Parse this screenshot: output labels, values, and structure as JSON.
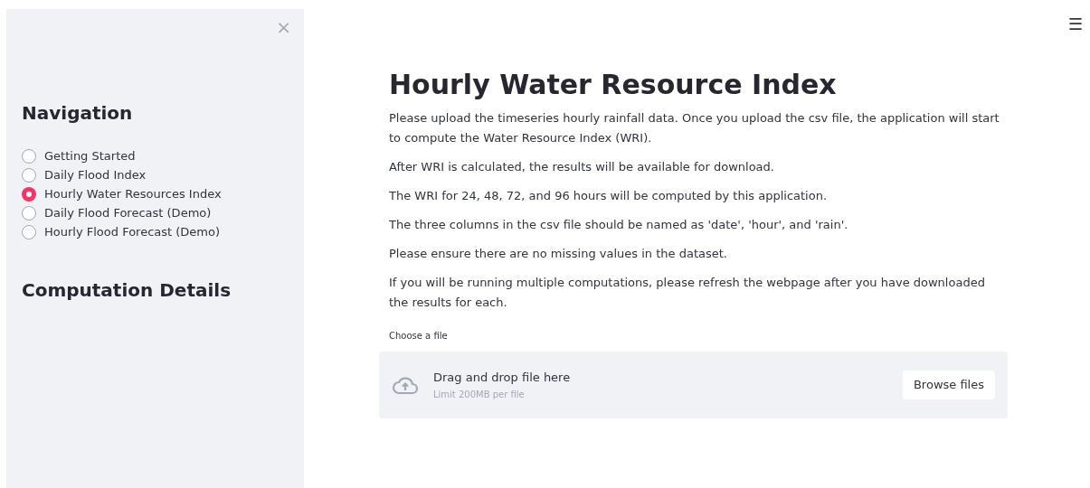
{
  "sidebar": {
    "close": "×",
    "headings": [
      "Navigation",
      "Computation Details"
    ],
    "nav": [
      {
        "label": "Getting Started",
        "selected": false
      },
      {
        "label": "Daily Flood Index",
        "selected": false
      },
      {
        "label": "Hourly Water Resources Index",
        "selected": true
      },
      {
        "label": "Daily Flood Forecast (Demo)",
        "selected": false
      },
      {
        "label": "Hourly Flood Forecast (Demo)",
        "selected": false
      }
    ]
  },
  "menu": "☰",
  "main": {
    "title": "Hourly Water Resource Index",
    "paragraphs": [
      "Please upload the timeseries hourly rainfall data. Once you upload the csv file, the application will start to compute the Water Resource Index (WRI).",
      "After WRI is calculated, the results will be available for download.",
      "The WRI for 24, 48, 72, and 96 hours will be computed by this application.",
      "The three columns in the csv file should be named as 'date', 'hour', and 'rain'.",
      "Please ensure there are no missing values in the dataset.",
      "If you will be running multiple computations, please refresh the webpage after you have downloaded the results for each."
    ],
    "uploader": {
      "label": "Choose a file",
      "title": "Drag and drop file here",
      "hint": "Limit 200MB per file",
      "button": "Browse files"
    }
  }
}
